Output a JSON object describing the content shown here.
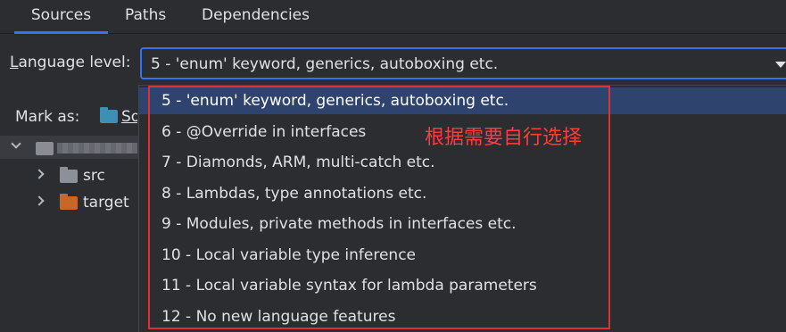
{
  "tabs": [
    {
      "label": "Sources",
      "active": true
    },
    {
      "label": "Paths",
      "active": false
    },
    {
      "label": "Dependencies",
      "active": false
    }
  ],
  "language_level": {
    "label_mnemonic": "L",
    "label_rest": "anguage level:",
    "selected": "5 - 'enum' keyword, generics, autoboxing etc."
  },
  "mark_as": {
    "label": "Mark as:",
    "sources_text": "So",
    "icon": "folder-icon"
  },
  "tree": {
    "root_label": "",
    "items": [
      {
        "label": "src",
        "icon": "folder-icon"
      },
      {
        "label": "target",
        "icon": "folder-icon",
        "color": "#c9672a"
      }
    ]
  },
  "dropdown": {
    "options": [
      "5 - 'enum' keyword, generics, autoboxing etc.",
      "6 - @Override in interfaces",
      "7 - Diamonds, ARM, multi-catch etc.",
      "8 - Lambdas, type annotations etc.",
      "9 - Modules, private methods in interfaces etc.",
      "10 - Local variable type inference",
      "11 - Local variable syntax for lambda parameters",
      "12 - No new language features"
    ],
    "selected_index": 0
  },
  "annotation": {
    "text": "根据需要自行选择",
    "color": "#e0312f"
  },
  "colors": {
    "background": "#2b2d30",
    "accent": "#3574f0",
    "selection": "#2e436e"
  }
}
